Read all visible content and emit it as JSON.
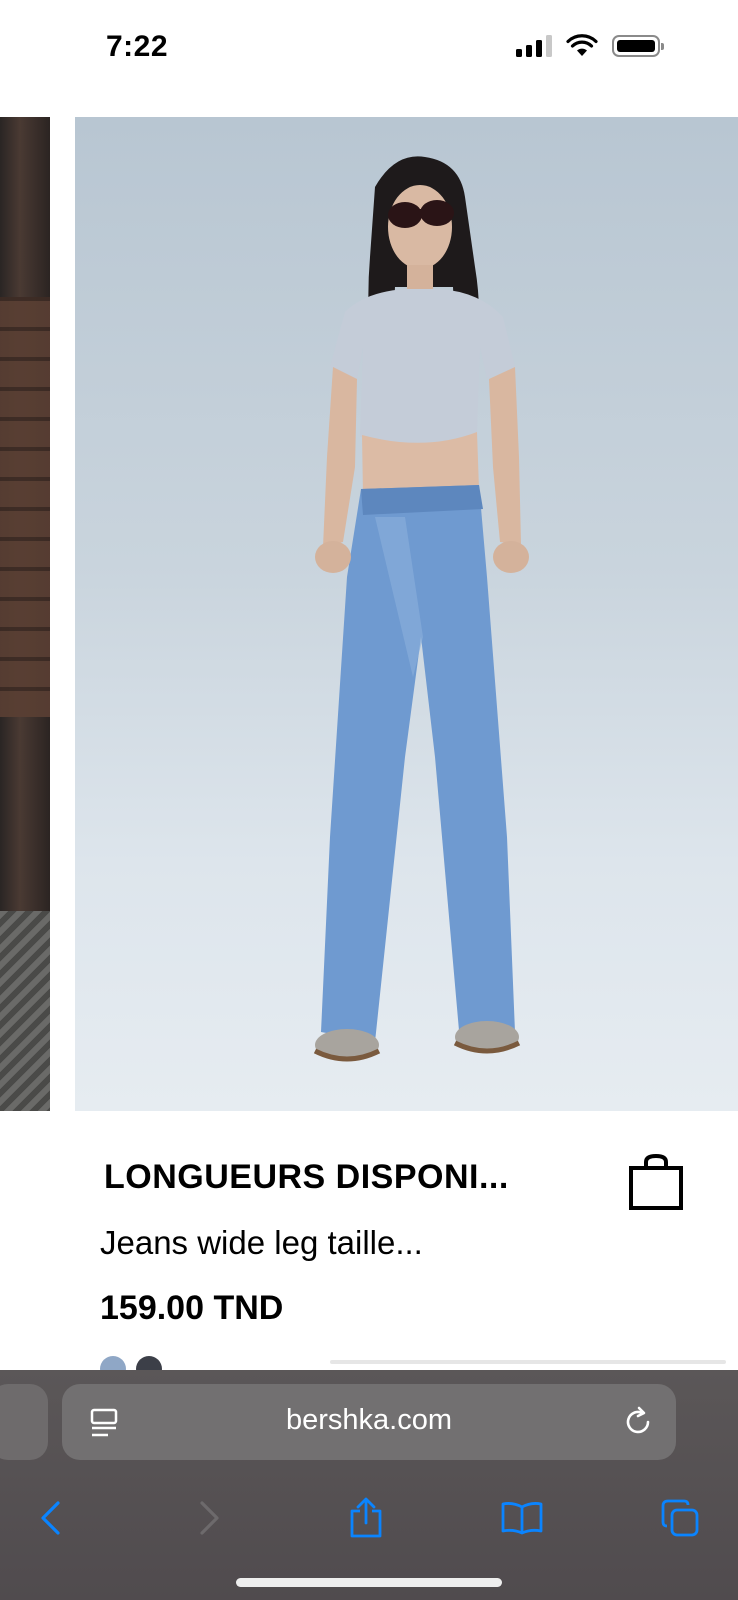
{
  "status_bar": {
    "time": "7:22"
  },
  "product": {
    "title": "LONGUEURS DISPONI...",
    "description": "Jeans wide leg taille...",
    "price": "159.00 TND",
    "swatches": [
      "#8fa7c6",
      "#3c3f48"
    ]
  },
  "browser": {
    "url": "bershka.com"
  },
  "colors": {
    "accent": "#0a84ff",
    "toolbar": "#545051"
  }
}
